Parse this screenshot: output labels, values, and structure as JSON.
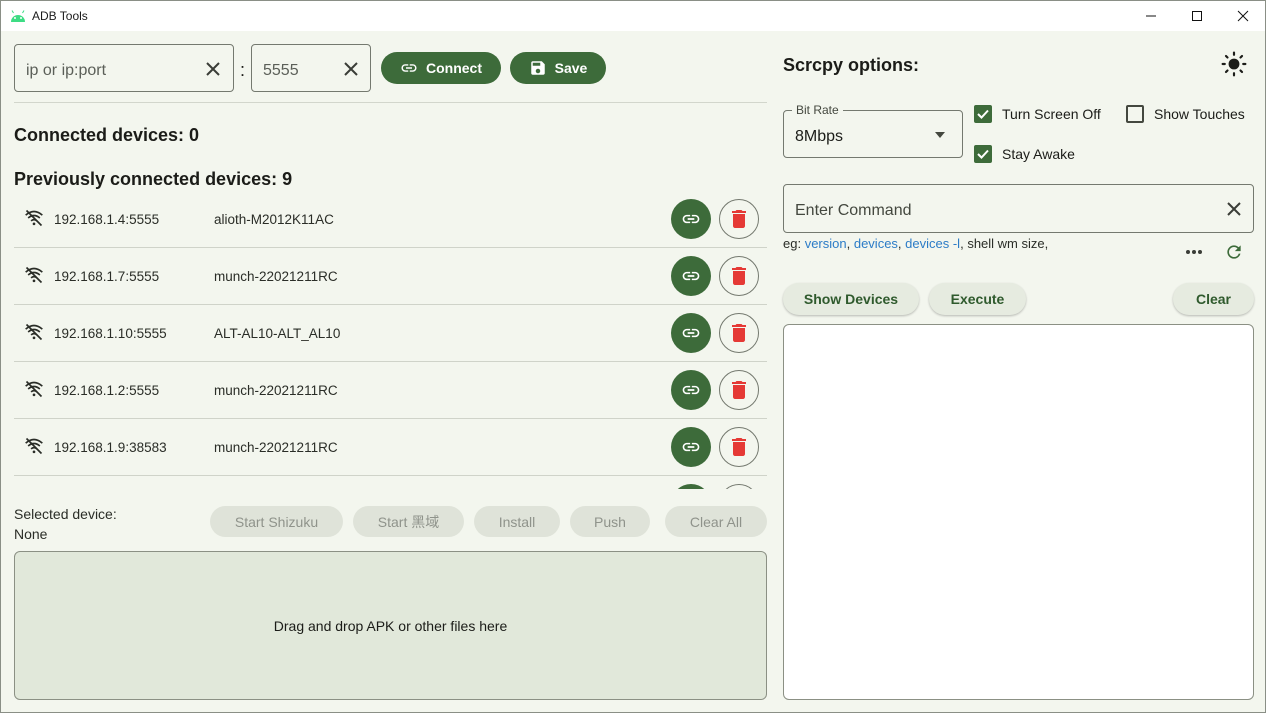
{
  "window": {
    "title": "ADB Tools"
  },
  "connect": {
    "ip_placeholder": "ip or ip:port",
    "separator": ":",
    "port_value": "5555",
    "connect_label": "Connect",
    "save_label": "Save"
  },
  "devices": {
    "connected_heading": "Connected devices: 0",
    "previous_heading": "Previously connected devices: 9",
    "items": [
      {
        "ip": "192.168.1.4:5555",
        "name": "alioth-M2012K11AC"
      },
      {
        "ip": "192.168.1.7:5555",
        "name": "munch-22021211RC"
      },
      {
        "ip": "192.168.1.10:5555",
        "name": "ALT-AL10-ALT_AL10"
      },
      {
        "ip": "192.168.1.2:5555",
        "name": "munch-22021211RC"
      },
      {
        "ip": "192.168.1.9:38583",
        "name": "munch-22021211RC"
      }
    ]
  },
  "selected": {
    "label": "Selected device:",
    "value": "None"
  },
  "actions": {
    "start_shizuku": "Start Shizuku",
    "start_heiyu": "Start 黑域",
    "install": "Install",
    "push": "Push",
    "clear_all": "Clear All"
  },
  "dropzone": {
    "text": "Drag and drop APK or other files here"
  },
  "scrcpy": {
    "heading": "Scrcpy options:",
    "bitrate_label": "Bit Rate",
    "bitrate_value": "8Mbps",
    "turn_screen_off": {
      "label": "Turn Screen Off",
      "checked": true
    },
    "show_touches": {
      "label": "Show Touches",
      "checked": false
    },
    "stay_awake": {
      "label": "Stay Awake",
      "checked": true
    }
  },
  "command": {
    "placeholder": "Enter Command",
    "eg_prefix": "eg: ",
    "examples": [
      "version",
      "devices",
      "devices -l"
    ],
    "eg_suffix": "shell wm size,",
    "show_devices": "Show Devices",
    "execute": "Execute",
    "clear": "Clear"
  },
  "colors": {
    "primary": "#3d6b3a",
    "danger": "#e53935",
    "link": "#2c7cc7",
    "background": "#f3f6ee"
  }
}
